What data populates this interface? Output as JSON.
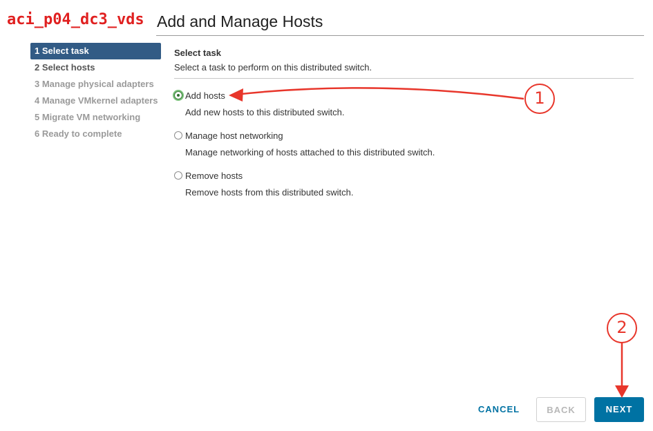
{
  "header": {
    "object_name": "aci_p04_dc3_vds",
    "title": "Add and Manage Hosts"
  },
  "steps": [
    {
      "label": "1 Select task",
      "state": "active"
    },
    {
      "label": "2 Select hosts",
      "state": "enabled"
    },
    {
      "label": "3 Manage physical adapters",
      "state": "disabled"
    },
    {
      "label": "4 Manage VMkernel adapters",
      "state": "disabled"
    },
    {
      "label": "5 Migrate VM networking",
      "state": "disabled"
    },
    {
      "label": "6 Ready to complete",
      "state": "disabled"
    }
  ],
  "content": {
    "title": "Select task",
    "description": "Select a task to perform on this distributed switch.",
    "options": [
      {
        "label": "Add hosts",
        "description": "Add new hosts to this distributed switch.",
        "selected": true
      },
      {
        "label": "Manage host networking",
        "description": "Manage networking of hosts attached to this distributed switch.",
        "selected": false
      },
      {
        "label": "Remove hosts",
        "description": "Remove hosts from this distributed switch.",
        "selected": false
      }
    ]
  },
  "footer": {
    "cancel": "CANCEL",
    "back": "BACK",
    "next": "NEXT"
  },
  "annotations": {
    "callout_1": "1",
    "callout_2": "2",
    "color": "#e8362b"
  },
  "colors": {
    "active_step_bg": "#325b85",
    "primary_button": "#0072a3",
    "object_name": "#e02020"
  }
}
